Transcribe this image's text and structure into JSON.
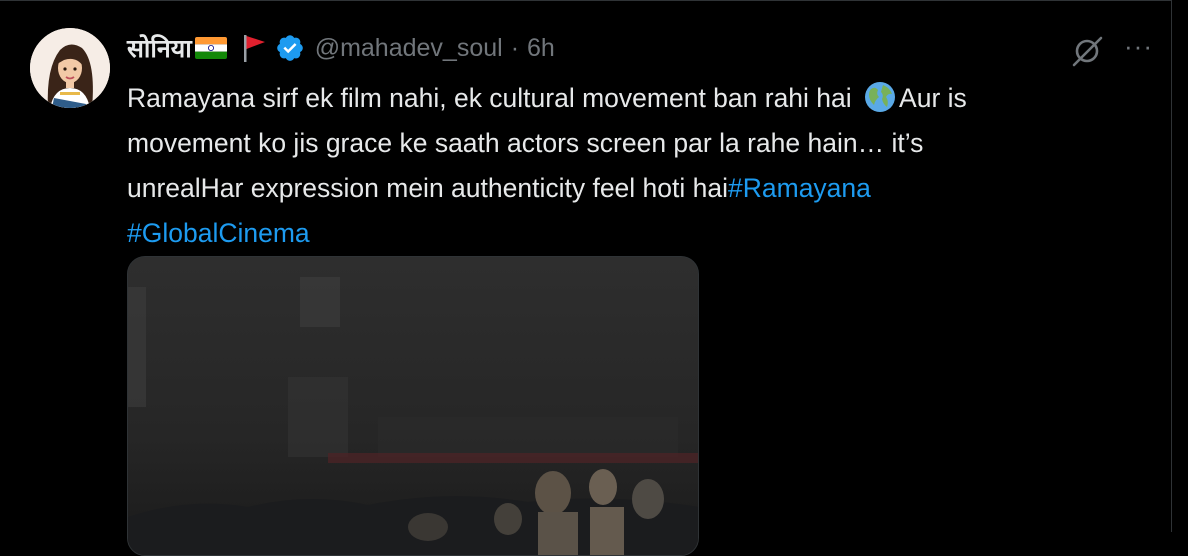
{
  "tweet": {
    "author": {
      "display_name": "सोनिया",
      "handle": "@mahadev_soul",
      "verified": true,
      "badges": [
        "india-flag-icon",
        "red-flag-icon",
        "verified-badge-icon"
      ]
    },
    "separator": "·",
    "timestamp": "6h",
    "text_parts": {
      "line1a": "Ramayana sirf ek film nahi, ek cultural movement ban rahi hai ",
      "line1b": "Aur is movement ko jis grace ke saath actors screen par la rahe hain… it’s unrealHar expression mein authenticity feel hoti hai",
      "hashtag1": "#Ramayana",
      "hashtag2": "#GlobalCinema"
    },
    "actions": {
      "more_label": "···"
    },
    "media": {
      "type": "video",
      "description_icon": "video-thumbnail"
    }
  },
  "colors": {
    "background": "#000000",
    "text": "#e7e9ea",
    "secondary": "#71767b",
    "accent": "#1d9bf0",
    "border": "#2f3336"
  }
}
